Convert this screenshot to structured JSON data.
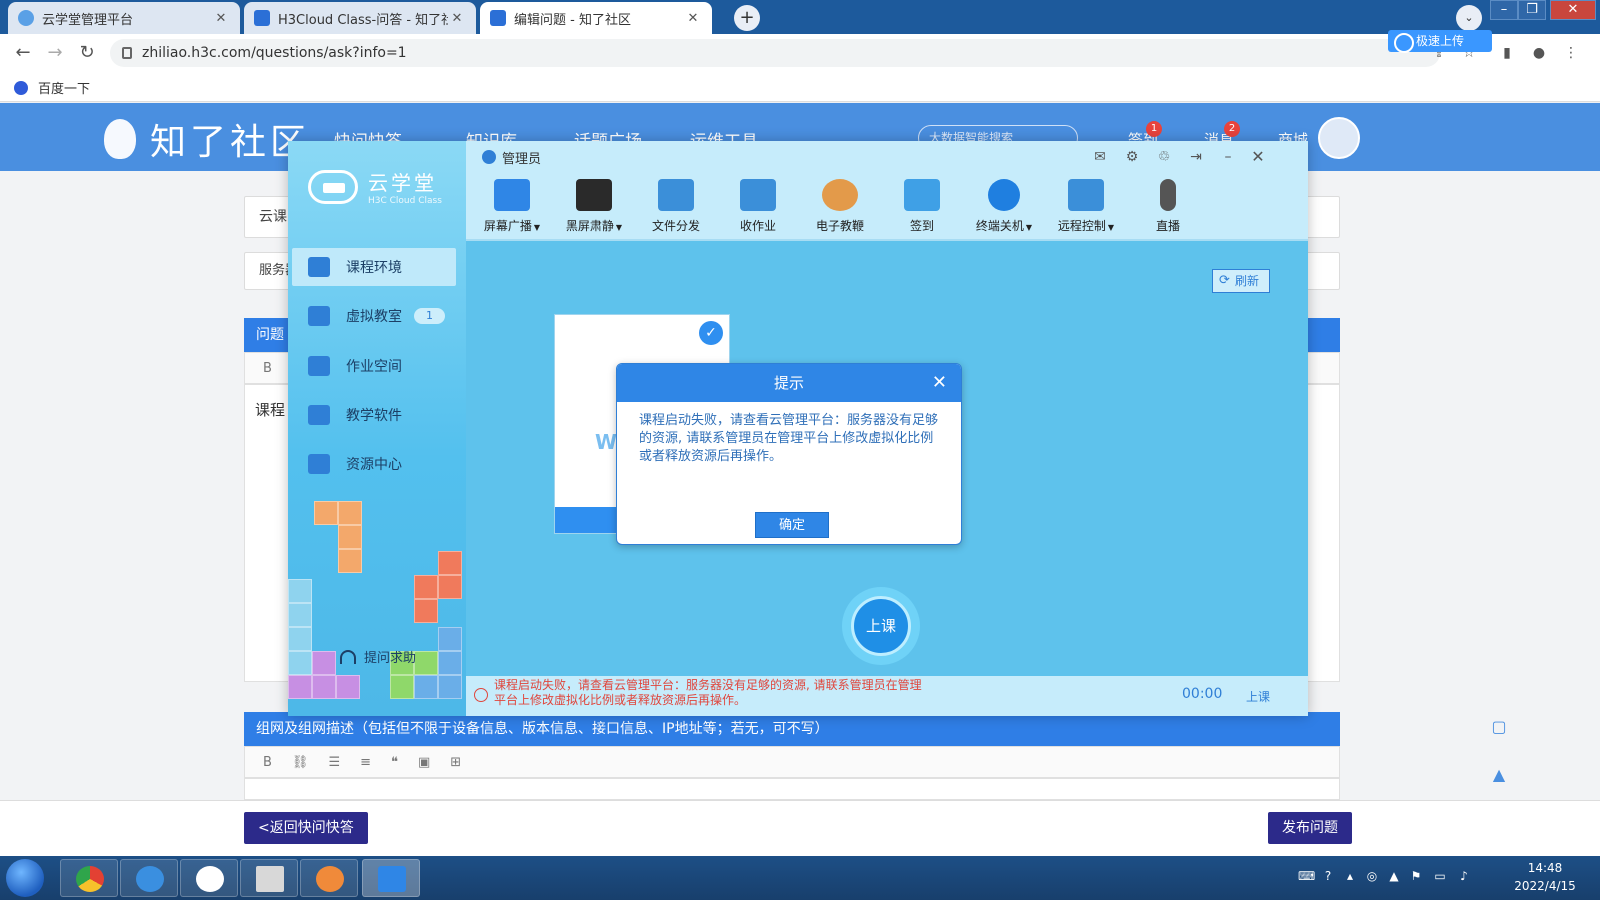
{
  "browser": {
    "tabs": [
      {
        "title": "云学堂管理平台",
        "active": false
      },
      {
        "title": "H3Cloud Class-问答 - 知了社区",
        "active": false
      },
      {
        "title": "编辑问题 - 知了社区",
        "active": true
      }
    ],
    "new_tab": "+",
    "url": "zhiliao.h3c.com/questions/ask?info=1",
    "baidu_pill": "极速上传",
    "bookmark": "百度一下"
  },
  "site": {
    "logo_text": "知了社区",
    "nav": [
      "快问快答",
      "知识库",
      "话题广场",
      "运维工具"
    ],
    "search_placeholder": "大数据智能搜索",
    "signin": "签到",
    "signin_badge": "1",
    "messages": "消息",
    "messages_badge": "2",
    "mall": "商城"
  },
  "form": {
    "title_value": "云课",
    "category_value": "服务器",
    "problem_header": "问题",
    "body_text": "课程",
    "network_header": "组网及组网描述（包括但不限于设备信息、版本信息、接口信息、IP地址等；若无，可不写）",
    "back_button": "<返回快问快答",
    "publish_button": "发布问题"
  },
  "app": {
    "logo_cn": "云学堂",
    "logo_en": "H3C Cloud Class",
    "title": "管理员",
    "menu": [
      {
        "label": "课程环境",
        "icon": "windows-icon",
        "active": true
      },
      {
        "label": "虚拟教室",
        "icon": "classroom-icon",
        "count": "1"
      },
      {
        "label": "作业空间",
        "icon": "homework-icon"
      },
      {
        "label": "教学软件",
        "icon": "software-icon"
      },
      {
        "label": "资源中心",
        "icon": "resource-icon"
      }
    ],
    "help": "提问求助",
    "toolbar": [
      {
        "label": "屏幕广播",
        "dropdown": true,
        "icon": "broadcast-icon",
        "color": "#2f86e6"
      },
      {
        "label": "黑屏肃静",
        "dropdown": true,
        "icon": "blackscreen-icon",
        "color": "#2a2a2a"
      },
      {
        "label": "文件分发",
        "dropdown": false,
        "icon": "file-send-icon",
        "color": "#3b8fd9"
      },
      {
        "label": "收作业",
        "dropdown": false,
        "icon": "collect-icon",
        "color": "#3b8fd9"
      },
      {
        "label": "电子教鞭",
        "dropdown": false,
        "icon": "palette-icon",
        "color": "#e39a4a"
      },
      {
        "label": "签到",
        "dropdown": false,
        "icon": "calendar-icon",
        "color": "#3fa0e6"
      },
      {
        "label": "终端关机",
        "dropdown": true,
        "icon": "power-icon",
        "color": "#1f7fe0"
      },
      {
        "label": "远程控制",
        "dropdown": true,
        "icon": "remote-icon",
        "color": "#3b8fd9"
      },
      {
        "label": "直播",
        "dropdown": false,
        "icon": "mic-icon",
        "color": "#555"
      }
    ],
    "refresh": "刷新",
    "card_text": "W",
    "start_button": "上课",
    "status_error": "课程启动失败，请查看云管理平台：服务器没有足够的资源, 请联系管理员在管理平台上修改虚拟化比例或者释放资源后再操作。",
    "timer": "00:00",
    "status_label": "上课"
  },
  "dialog": {
    "title": "提示",
    "message": "课程启动失败，请查看云管理平台：服务器没有足够的资源, 请联系管理员在管理平台上修改虚拟化比例或者释放资源后再操作。",
    "ok": "确定"
  },
  "taskbar": {
    "time": "14:48",
    "date": "2022/4/15"
  },
  "colors": {
    "site_blue": "#4a8fe0",
    "app_bg": "#5ec2ec",
    "error_red": "#e0463c",
    "button_purple": "#2c2a8a"
  }
}
